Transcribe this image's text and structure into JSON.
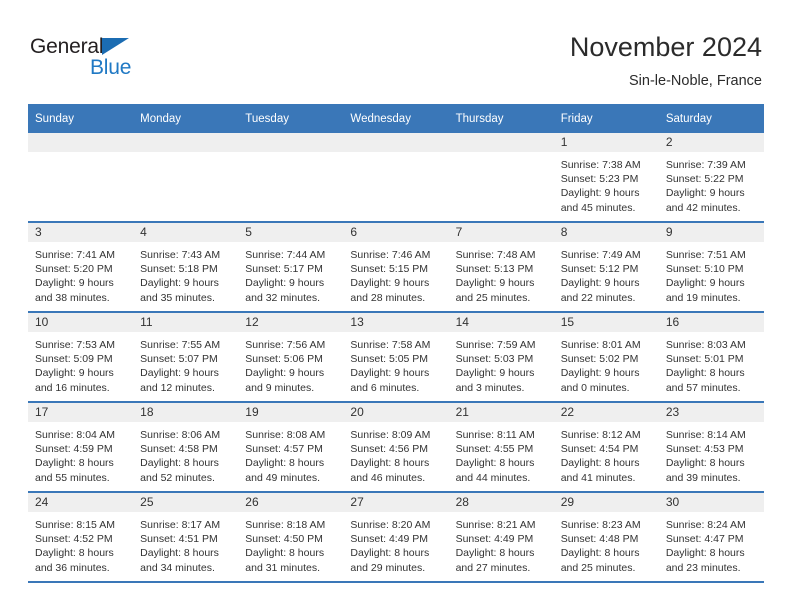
{
  "brand": {
    "name_top": "General",
    "name_bottom": "Blue",
    "triangle_color": "#1b6cb2",
    "blue_color": "#2079c4"
  },
  "header": {
    "title": "November 2024",
    "subtitle": "Sin-le-Noble, France"
  },
  "theme": {
    "header_blue": "#3a77b8",
    "daynum_band": "#efefef",
    "text": "#333333"
  },
  "calendar": {
    "weekday_headers": [
      "Sunday",
      "Monday",
      "Tuesday",
      "Wednesday",
      "Thursday",
      "Friday",
      "Saturday"
    ],
    "weeks": [
      [
        {
          "day": "",
          "lines": []
        },
        {
          "day": "",
          "lines": []
        },
        {
          "day": "",
          "lines": []
        },
        {
          "day": "",
          "lines": []
        },
        {
          "day": "",
          "lines": []
        },
        {
          "day": "1",
          "lines": [
            "Sunrise: 7:38 AM",
            "Sunset: 5:23 PM",
            "Daylight: 9 hours",
            "and 45 minutes."
          ]
        },
        {
          "day": "2",
          "lines": [
            "Sunrise: 7:39 AM",
            "Sunset: 5:22 PM",
            "Daylight: 9 hours",
            "and 42 minutes."
          ]
        }
      ],
      [
        {
          "day": "3",
          "lines": [
            "Sunrise: 7:41 AM",
            "Sunset: 5:20 PM",
            "Daylight: 9 hours",
            "and 38 minutes."
          ]
        },
        {
          "day": "4",
          "lines": [
            "Sunrise: 7:43 AM",
            "Sunset: 5:18 PM",
            "Daylight: 9 hours",
            "and 35 minutes."
          ]
        },
        {
          "day": "5",
          "lines": [
            "Sunrise: 7:44 AM",
            "Sunset: 5:17 PM",
            "Daylight: 9 hours",
            "and 32 minutes."
          ]
        },
        {
          "day": "6",
          "lines": [
            "Sunrise: 7:46 AM",
            "Sunset: 5:15 PM",
            "Daylight: 9 hours",
            "and 28 minutes."
          ]
        },
        {
          "day": "7",
          "lines": [
            "Sunrise: 7:48 AM",
            "Sunset: 5:13 PM",
            "Daylight: 9 hours",
            "and 25 minutes."
          ]
        },
        {
          "day": "8",
          "lines": [
            "Sunrise: 7:49 AM",
            "Sunset: 5:12 PM",
            "Daylight: 9 hours",
            "and 22 minutes."
          ]
        },
        {
          "day": "9",
          "lines": [
            "Sunrise: 7:51 AM",
            "Sunset: 5:10 PM",
            "Daylight: 9 hours",
            "and 19 minutes."
          ]
        }
      ],
      [
        {
          "day": "10",
          "lines": [
            "Sunrise: 7:53 AM",
            "Sunset: 5:09 PM",
            "Daylight: 9 hours",
            "and 16 minutes."
          ]
        },
        {
          "day": "11",
          "lines": [
            "Sunrise: 7:55 AM",
            "Sunset: 5:07 PM",
            "Daylight: 9 hours",
            "and 12 minutes."
          ]
        },
        {
          "day": "12",
          "lines": [
            "Sunrise: 7:56 AM",
            "Sunset: 5:06 PM",
            "Daylight: 9 hours",
            "and 9 minutes."
          ]
        },
        {
          "day": "13",
          "lines": [
            "Sunrise: 7:58 AM",
            "Sunset: 5:05 PM",
            "Daylight: 9 hours",
            "and 6 minutes."
          ]
        },
        {
          "day": "14",
          "lines": [
            "Sunrise: 7:59 AM",
            "Sunset: 5:03 PM",
            "Daylight: 9 hours",
            "and 3 minutes."
          ]
        },
        {
          "day": "15",
          "lines": [
            "Sunrise: 8:01 AM",
            "Sunset: 5:02 PM",
            "Daylight: 9 hours",
            "and 0 minutes."
          ]
        },
        {
          "day": "16",
          "lines": [
            "Sunrise: 8:03 AM",
            "Sunset: 5:01 PM",
            "Daylight: 8 hours",
            "and 57 minutes."
          ]
        }
      ],
      [
        {
          "day": "17",
          "lines": [
            "Sunrise: 8:04 AM",
            "Sunset: 4:59 PM",
            "Daylight: 8 hours",
            "and 55 minutes."
          ]
        },
        {
          "day": "18",
          "lines": [
            "Sunrise: 8:06 AM",
            "Sunset: 4:58 PM",
            "Daylight: 8 hours",
            "and 52 minutes."
          ]
        },
        {
          "day": "19",
          "lines": [
            "Sunrise: 8:08 AM",
            "Sunset: 4:57 PM",
            "Daylight: 8 hours",
            "and 49 minutes."
          ]
        },
        {
          "day": "20",
          "lines": [
            "Sunrise: 8:09 AM",
            "Sunset: 4:56 PM",
            "Daylight: 8 hours",
            "and 46 minutes."
          ]
        },
        {
          "day": "21",
          "lines": [
            "Sunrise: 8:11 AM",
            "Sunset: 4:55 PM",
            "Daylight: 8 hours",
            "and 44 minutes."
          ]
        },
        {
          "day": "22",
          "lines": [
            "Sunrise: 8:12 AM",
            "Sunset: 4:54 PM",
            "Daylight: 8 hours",
            "and 41 minutes."
          ]
        },
        {
          "day": "23",
          "lines": [
            "Sunrise: 8:14 AM",
            "Sunset: 4:53 PM",
            "Daylight: 8 hours",
            "and 39 minutes."
          ]
        }
      ],
      [
        {
          "day": "24",
          "lines": [
            "Sunrise: 8:15 AM",
            "Sunset: 4:52 PM",
            "Daylight: 8 hours",
            "and 36 minutes."
          ]
        },
        {
          "day": "25",
          "lines": [
            "Sunrise: 8:17 AM",
            "Sunset: 4:51 PM",
            "Daylight: 8 hours",
            "and 34 minutes."
          ]
        },
        {
          "day": "26",
          "lines": [
            "Sunrise: 8:18 AM",
            "Sunset: 4:50 PM",
            "Daylight: 8 hours",
            "and 31 minutes."
          ]
        },
        {
          "day": "27",
          "lines": [
            "Sunrise: 8:20 AM",
            "Sunset: 4:49 PM",
            "Daylight: 8 hours",
            "and 29 minutes."
          ]
        },
        {
          "day": "28",
          "lines": [
            "Sunrise: 8:21 AM",
            "Sunset: 4:49 PM",
            "Daylight: 8 hours",
            "and 27 minutes."
          ]
        },
        {
          "day": "29",
          "lines": [
            "Sunrise: 8:23 AM",
            "Sunset: 4:48 PM",
            "Daylight: 8 hours",
            "and 25 minutes."
          ]
        },
        {
          "day": "30",
          "lines": [
            "Sunrise: 8:24 AM",
            "Sunset: 4:47 PM",
            "Daylight: 8 hours",
            "and 23 minutes."
          ]
        }
      ]
    ]
  }
}
